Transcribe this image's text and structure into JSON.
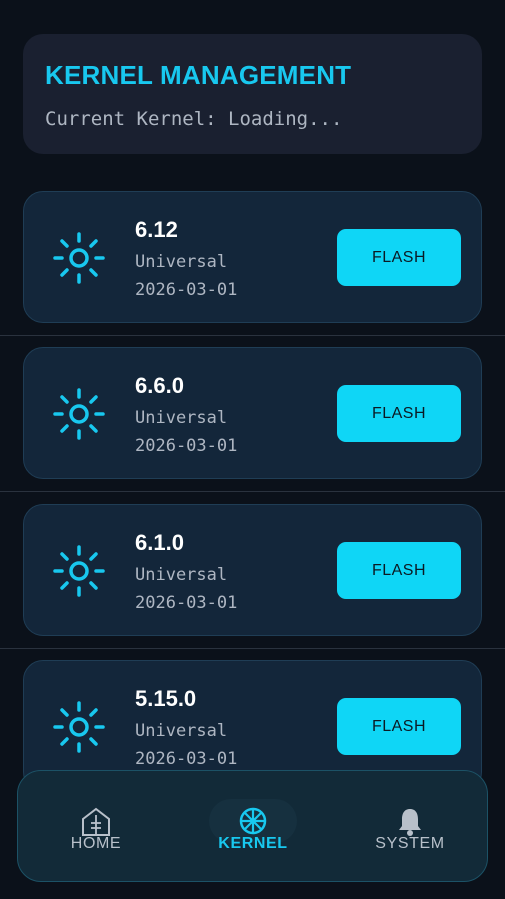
{
  "header": {
    "title": "KERNEL MANAGEMENT",
    "subtitle": "Current Kernel: Loading..."
  },
  "kernels": [
    {
      "version": "6.12",
      "type": "Universal",
      "date": "2026-03-01",
      "action": "FLASH"
    },
    {
      "version": "6.6.0",
      "type": "Universal",
      "date": "2026-03-01",
      "action": "FLASH"
    },
    {
      "version": "6.1.0",
      "type": "Universal",
      "date": "2026-03-01",
      "action": "FLASH"
    },
    {
      "version": "5.15.0",
      "type": "Universal",
      "date": "2026-03-01",
      "action": "FLASH"
    }
  ],
  "nav": {
    "home": "HOME",
    "kernel": "KERNEL",
    "system": "SYSTEM",
    "active": "kernel"
  },
  "colors": {
    "accent": "#18c8ef",
    "button": "#0fd6f6",
    "background": "#0b111a",
    "card": "#13263a"
  },
  "icons": {
    "kernel_item": "sun-icon",
    "home": "home-icon",
    "kernel": "wheel-icon",
    "system": "bell-icon"
  }
}
